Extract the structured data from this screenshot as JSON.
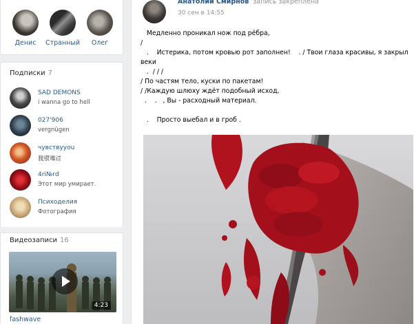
{
  "friends": [
    {
      "name": "Денис"
    },
    {
      "name": "Странный"
    },
    {
      "name": "Олег"
    }
  ],
  "subscriptions": {
    "title": "Подписки",
    "count": "7",
    "items": [
      {
        "name": "SAD DEMONS",
        "status": "i wanna go to hell"
      },
      {
        "name": "027'906",
        "status": "vergnügen"
      },
      {
        "name": "чувствуyou",
        "status": "我很难过"
      },
      {
        "name": "4ri№rd",
        "status": "Этот мир умирает."
      },
      {
        "name": "Психоделия",
        "status": "Фотография"
      }
    ]
  },
  "videos": {
    "title": "Видеозаписи",
    "count": "16",
    "item": {
      "title": "fashwave",
      "duration": "4:23"
    }
  },
  "post": {
    "author": "Анатолий Смирнов",
    "pinned_label": "запись закреплена",
    "date": "30 сен в 14:55",
    "lines": [
      "   Медленно проникал нож под рёбра,",
      "/",
      "   .    Истерика, потом кровью рот заполнен!    . / Твои глаза красивы, я закрыл",
      "веки",
      "   .  / / /",
      "/ По частям тело, куски по пакетам!",
      "/ /Каждую шлюху ждёт подобный исход,",
      "  .    .   , Вы - расходный материал.",
      "",
      "   .    Просто выебал и в гроб ."
    ]
  },
  "colors": {
    "link": "#2a5885",
    "muted": "#939393",
    "background": "#edeef0",
    "blood": "#a3101c"
  }
}
